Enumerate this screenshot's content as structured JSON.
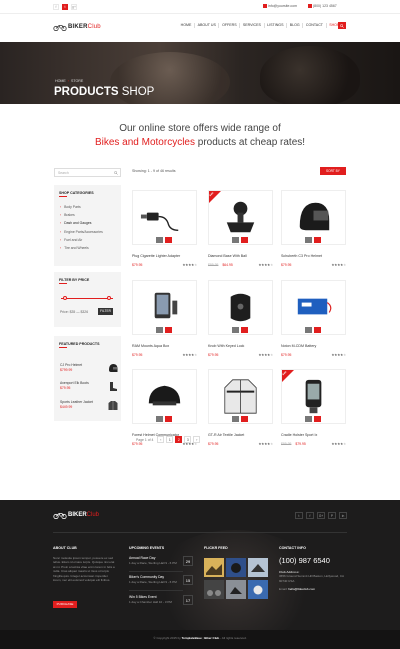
{
  "topbar": {
    "social": [
      "f",
      "t",
      "g+"
    ],
    "email": "info@yoursite.com",
    "phone": "(800) 123 4567"
  },
  "header": {
    "logo_main": "BIKER",
    "logo_accent": "Club",
    "nav": [
      {
        "label": "Home",
        "active": false
      },
      {
        "label": "About Us",
        "active": false
      },
      {
        "label": "Offers",
        "active": false
      },
      {
        "label": "Services",
        "active": false
      },
      {
        "label": "Listings",
        "active": false
      },
      {
        "label": "Blog",
        "active": false
      },
      {
        "label": "Contact",
        "active": false
      },
      {
        "label": "Shop",
        "active": true
      }
    ]
  },
  "hero": {
    "crumb_home": "Home",
    "crumb_current": "Store",
    "title_bold": "Products",
    "title_thin": "Shop"
  },
  "intro": {
    "line1": "Our online store offers wide range of",
    "line2_red": "Bikes and Motorcycles",
    "line2_rest": " products at cheap rates!"
  },
  "sidebar": {
    "search_placeholder": "Search",
    "categories_title": "Shop Categories",
    "categories": [
      {
        "label": "Body Parts",
        "active": false
      },
      {
        "label": "Brakes",
        "active": false
      },
      {
        "label": "Dash and Gauges",
        "active": true
      },
      {
        "label": "Engine Parts/Accessories",
        "active": false
      },
      {
        "label": "Fuel and Air",
        "active": false
      },
      {
        "label": "Tire and Wheels",
        "active": false
      }
    ],
    "filter_title": "Filter By Price",
    "price_text": "Price: $35 — $326",
    "filter_button": "Filter",
    "price_min_fraction": 0.08,
    "price_max_fraction": 0.92,
    "featured_title": "Featured Products",
    "featured": [
      {
        "name": "CJ Pro Helmet",
        "price": "$799.99"
      },
      {
        "name": "Avenport Elk Boots",
        "price": "$79.95"
      },
      {
        "name": "Sports Leather Jacket",
        "price": "$449.99"
      }
    ]
  },
  "products_header": {
    "showing": "Showing: 1 - 9 of 46 results",
    "sort_button": "Sort by"
  },
  "products": [
    {
      "name": "Plug Cigarette Lighter Adapter",
      "old_price": "",
      "price": "$79.95",
      "rating": 4,
      "sale": false,
      "icon": "cable-adapter"
    },
    {
      "name": "Diamond Base With Ball",
      "old_price": "$89.95",
      "price": "$64.95",
      "rating": 4,
      "sale": true,
      "icon": "ball-mount"
    },
    {
      "name": "Schuberth C3 Pro Helmet",
      "old_price": "",
      "price": "$79.95",
      "rating": 4,
      "sale": false,
      "icon": "helmet"
    },
    {
      "name": "RAM Mounts Aqua Box",
      "old_price": "",
      "price": "$79.95",
      "rating": 4,
      "sale": false,
      "icon": "phone-case"
    },
    {
      "name": "Knob With Keyed Lock",
      "old_price": "",
      "price": "$79.95",
      "rating": 4,
      "sale": false,
      "icon": "knob"
    },
    {
      "name": "Noton M-CDM Battery",
      "old_price": "",
      "price": "$79.95",
      "rating": 4,
      "sale": false,
      "icon": "battery"
    },
    {
      "name": "Forest Helmet Communicator",
      "old_price": "",
      "price": "$79.95",
      "rating": 4,
      "sale": false,
      "icon": "communicator"
    },
    {
      "name": "GT-R Air Textile Jacket",
      "old_price": "",
      "price": "$79.95",
      "rating": 4,
      "sale": false,
      "icon": "jacket"
    },
    {
      "name": "Cradle Holster Sport Ix",
      "old_price": "$89.95",
      "price": "$79.95",
      "rating": 4,
      "sale": true,
      "icon": "holster"
    }
  ],
  "sale_label": "Sale",
  "pager": {
    "label": "Page 1 of 4",
    "pages": [
      "‹",
      "1",
      "2",
      "3",
      "›"
    ],
    "active_index": 2
  },
  "footer": {
    "logo_main": "BIKER",
    "logo_accent": "Club",
    "social": [
      "t",
      "f",
      "G+",
      "P",
      "in"
    ],
    "about_title": "About Club",
    "about_text": "Nunc molestie ipsum tempor, posuere ex sed tellus. Etiam id ornare turpis. Quisque nisi erat at mi. Proin a lacinia vitae enim lorem in felis a nulla. Cras aliquet mauris ut risus ut turpis fringilla quis. Integer accumsan imperdiet lorem, nec elit euismod volutpat elit finibus.",
    "about_button": "Purchase",
    "events_title": "Upcoming Events",
    "events": [
      {
        "name": "Annual Race Day",
        "detail": "1 day a Race, Sterling Hall 9 - 6 PM",
        "day": "29"
      },
      {
        "name": "Biker's Community Day",
        "detail": "1 day a Race, Sterling Hall 9 - 6 PM",
        "day": "15"
      },
      {
        "name": "Win 5 Bikes Event",
        "detail": "1 day a Chamber Hall 10 - 3 PM",
        "day": "17"
      }
    ],
    "flickr_title": "Flickr Feed",
    "contact_title": "Contact Info",
    "phone": "(100) 987 6540",
    "address_title": "Club Address:",
    "address": "3656 Ground Summit Hill Baston, Hollywood, CA 90740 USA",
    "email_label": "Email:",
    "email": "hello@bikeclub.com",
    "copyright_pre": "© Copyright 2015 by ",
    "copyright_brand": "TemplateBase",
    "copyright_mid": " | ",
    "copyright_brand2": "Biker Club",
    "copyright_post": " - All rights reserved."
  },
  "colors": {
    "accent": "#e11e1e",
    "dark_footer": "#1d1c1c"
  }
}
